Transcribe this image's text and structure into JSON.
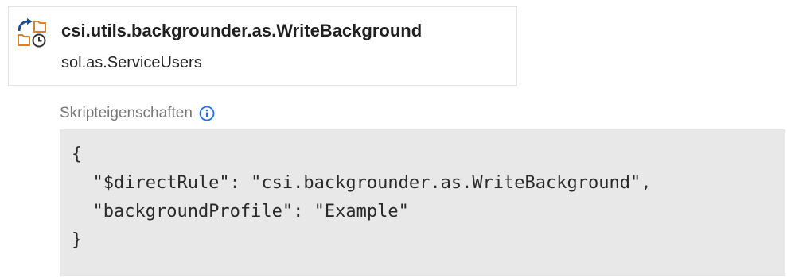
{
  "card": {
    "icon": "scheduled-script-icon",
    "title": "csi.utils.backgrounder.as.WriteBackground",
    "subtitle": "sol.as.ServiceUsers"
  },
  "section": {
    "label": "Skripteigenschaften",
    "info_icon": "info-icon"
  },
  "code": {
    "lines": [
      "{",
      "  \"$directRule\": \"csi.backgrounder.as.WriteBackground\",",
      "  \"backgroundProfile\": \"Example\"",
      "}"
    ]
  },
  "colors": {
    "icon_blue": "#1f4f8f",
    "icon_orange": "#d9822b",
    "info_blue": "#1a73e8",
    "code_background": "#e8e8e8"
  }
}
